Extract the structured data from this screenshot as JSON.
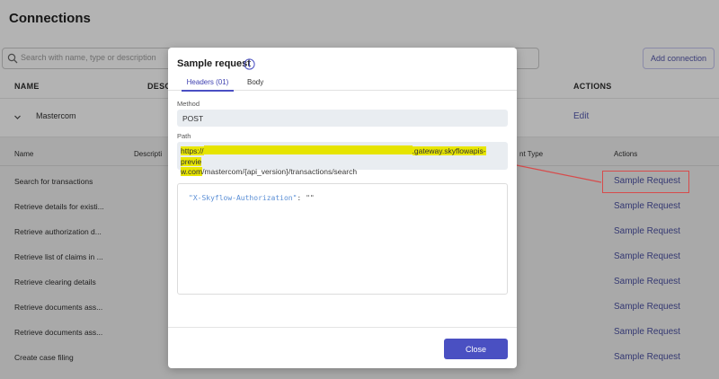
{
  "page": {
    "title": "Connections",
    "search_placeholder": "Search with name, type or description",
    "add_connection_label": "Add connection",
    "columns": {
      "name": "NAME",
      "description": "DESC",
      "actions": "ACTIONS"
    },
    "group": {
      "name": "Mastercom",
      "edit_label": "Edit"
    },
    "sub_columns": {
      "name": "Name",
      "description": "Descripti",
      "content_type": "nt Type",
      "actions": "Actions"
    },
    "rows": [
      {
        "name": "Search for transactions",
        "action": "Sample Request"
      },
      {
        "name": "Retrieve details for existi...",
        "action": "Sample Request"
      },
      {
        "name": "Retrieve authorization d...",
        "action": "Sample Request"
      },
      {
        "name": "Retrieve list of claims in ...",
        "action": "Sample Request"
      },
      {
        "name": "Retrieve clearing details",
        "action": "Sample Request"
      },
      {
        "name": "Retrieve documents ass...",
        "action": "Sample Request"
      },
      {
        "name": "Retrieve documents ass...",
        "action": "Sample Request"
      },
      {
        "name": "Create case filing",
        "action": "Sample Request"
      }
    ]
  },
  "modal": {
    "title": "Sample request",
    "tabs": [
      {
        "label": "Headers (01)",
        "active": true
      },
      {
        "label": "Body",
        "active": false
      }
    ],
    "method_label": "Method",
    "method_value": "POST",
    "path_label": "Path",
    "path_prefix": "https://",
    "path_gateway": ".gateway.skyflowapis-previe",
    "path_wrap": "w.com",
    "path_rest": "/mastercom/{api_version}/transactions/search",
    "header_key": "\"X-Skyflow-Authorization\"",
    "header_sep": ": ",
    "header_value": "\"\"",
    "close_label": "Close"
  },
  "colors": {
    "accent": "#4a50c2",
    "highlight": "#e8e600",
    "annotation_red": "#d74b4b"
  }
}
